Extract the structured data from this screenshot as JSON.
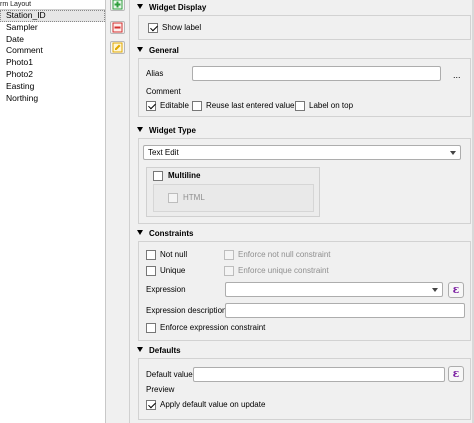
{
  "tree": {
    "header": "rm Layout",
    "items": [
      "Station_ID",
      "Sampler",
      "Date",
      "Comment",
      "Photo1",
      "Photo2",
      "Easting",
      "Northing"
    ],
    "selected_index": 0
  },
  "toolbar": {
    "icons": [
      "add-icon",
      "remove-icon",
      "edit-icon"
    ]
  },
  "widget_display": {
    "title": "Widget Display",
    "show_label": "Show label",
    "show_label_checked": true
  },
  "general": {
    "title": "General",
    "alias_label": "Alias",
    "alias_value": "",
    "alias_menu": "...",
    "comment_label": "Comment",
    "editable_label": "Editable",
    "editable_checked": true,
    "reuse_label": "Reuse last entered value",
    "reuse_checked": false,
    "label_on_top_label": "Label on top",
    "label_on_top_checked": false
  },
  "widget_type": {
    "title": "Widget Type",
    "selected": "Text Edit",
    "multiline_label": "Multiline",
    "multiline_checked": false,
    "html_label": "HTML",
    "html_checked": false
  },
  "constraints": {
    "title": "Constraints",
    "not_null_label": "Not null",
    "not_null_checked": false,
    "enforce_not_null_label": "Enforce not null constraint",
    "unique_label": "Unique",
    "unique_checked": false,
    "enforce_unique_label": "Enforce unique constraint",
    "expression_label": "Expression",
    "expression_value": "",
    "expr_button": "ε",
    "expression_description_label": "Expression description",
    "expression_description_value": "",
    "enforce_expression_label": "Enforce expression constraint",
    "enforce_expression_checked": false
  },
  "defaults": {
    "title": "Defaults",
    "default_value_label": "Default value",
    "default_value": "",
    "expr_button": "ε",
    "preview_label": "Preview",
    "apply_on_update_label": "Apply default value on update",
    "apply_on_update_checked": true
  },
  "colors": {
    "expr_icon": "#7b1fa2",
    "add_icon": "#2e9e3c",
    "remove_icon": "#d32f2f",
    "edit_icon": "#e0a800"
  }
}
